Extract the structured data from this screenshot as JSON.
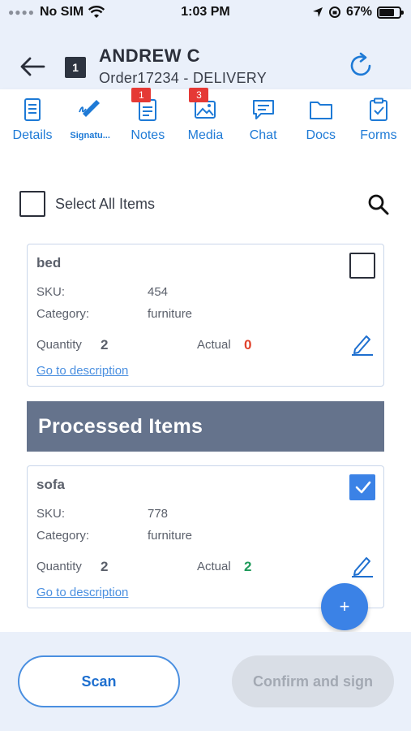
{
  "status_bar": {
    "carrier": "No SIM",
    "time": "1:03 PM",
    "battery": "67%"
  },
  "header": {
    "route_number": "1",
    "customer_name": "ANDREW C",
    "order_line": "Order17234 - DELIVERY"
  },
  "tabs": [
    {
      "label": "Details",
      "icon": "details-icon",
      "badge": ""
    },
    {
      "label": "Signatu...",
      "icon": "signature-icon",
      "badge": ""
    },
    {
      "label": "Notes",
      "icon": "notes-icon",
      "badge": "1"
    },
    {
      "label": "Media",
      "icon": "media-icon",
      "badge": "3"
    },
    {
      "label": "Chat",
      "icon": "chat-icon",
      "badge": ""
    },
    {
      "label": "Docs",
      "icon": "docs-icon",
      "badge": ""
    },
    {
      "label": "Forms",
      "icon": "forms-icon",
      "badge": ""
    }
  ],
  "select_all_label": "Select All Items",
  "items": [
    {
      "name": "bed",
      "sku_label": "SKU:",
      "sku": "454",
      "category_label": "Category:",
      "category": "furniture",
      "quantity_label": "Quantity",
      "quantity": "2",
      "actual_label": "Actual",
      "actual": "0",
      "link": "Go to description",
      "checked": false
    }
  ],
  "processed_header": "Processed Items",
  "processed_items": [
    {
      "name": "sofa",
      "sku_label": "SKU:",
      "sku": "778",
      "category_label": "Category:",
      "category": "furniture",
      "quantity_label": "Quantity",
      "quantity": "2",
      "actual_label": "Actual",
      "actual": "2",
      "link": "Go to description",
      "checked": true
    }
  ],
  "fab_label": "+",
  "footer": {
    "scan_label": "Scan",
    "confirm_label": "Confirm and sign"
  },
  "colors": {
    "accent": "#1e7ad6",
    "badge": "#e53935",
    "actual_zero": "#e0412a",
    "actual_ok": "#1f9a5a",
    "processed_bg": "#65738c"
  }
}
